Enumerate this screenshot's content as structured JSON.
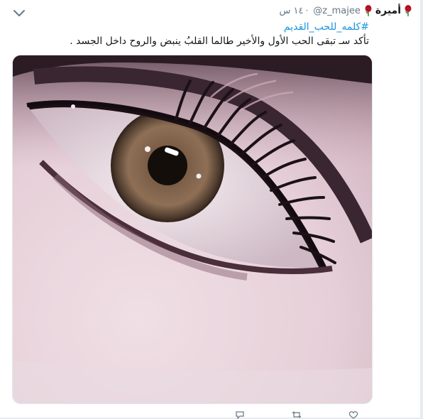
{
  "tweet": {
    "display_name": "أميرة",
    "handle": "@z_majee",
    "separator": "·",
    "timestamp": "١٤ س",
    "hashtag": "#كلمه_للحب_القديم",
    "text": "تأكد سـ تبقى الحب الأول والأخير طالما القلبُ ينبض والروح داخل الجسد ."
  },
  "icons": {
    "menu": "chevron-down-icon",
    "emoji": "rose-icon",
    "actions": [
      "reply-icon",
      "retweet-icon",
      "like-icon"
    ]
  },
  "colors": {
    "name": "#14171a",
    "meta": "#657786",
    "link": "#1b95e0",
    "background": "#ffffff",
    "rose": "#c0152a"
  }
}
